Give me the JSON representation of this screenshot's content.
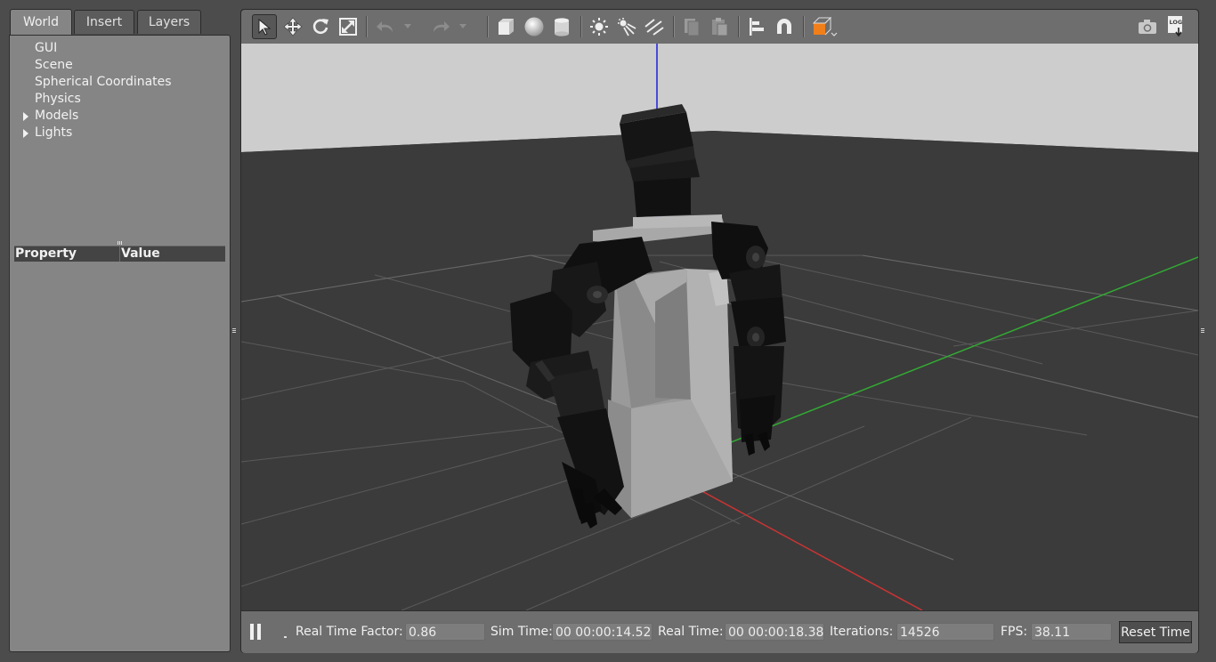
{
  "left_panel": {
    "tabs": [
      {
        "label": "World",
        "active": true
      },
      {
        "label": "Insert",
        "active": false
      },
      {
        "label": "Layers",
        "active": false
      }
    ],
    "tree": [
      {
        "label": "GUI",
        "expandable": false
      },
      {
        "label": "Scene",
        "expandable": false
      },
      {
        "label": "Spherical Coordinates",
        "expandable": false
      },
      {
        "label": "Physics",
        "expandable": false
      },
      {
        "label": "Models",
        "expandable": true
      },
      {
        "label": "Lights",
        "expandable": true
      }
    ],
    "property_header": {
      "property": "Property",
      "value": "Value"
    }
  },
  "toolbar": {
    "tools": [
      {
        "icon": "select-arrow-icon",
        "selected": true
      },
      {
        "icon": "translate-icon"
      },
      {
        "icon": "rotate-icon"
      },
      {
        "icon": "scale-icon"
      },
      {
        "icon": "undo-icon",
        "disabled": true
      },
      {
        "icon": "undo-history-icon",
        "disabled": true
      },
      {
        "icon": "redo-icon",
        "disabled": true
      },
      {
        "icon": "redo-history-icon",
        "disabled": true
      },
      {
        "icon": "box-icon"
      },
      {
        "icon": "sphere-icon"
      },
      {
        "icon": "cylinder-icon"
      },
      {
        "icon": "point-light-icon"
      },
      {
        "icon": "spot-light-icon"
      },
      {
        "icon": "directional-light-icon"
      },
      {
        "icon": "copy-icon"
      },
      {
        "icon": "paste-icon"
      },
      {
        "icon": "align-icon"
      },
      {
        "icon": "snap-icon"
      },
      {
        "icon": "view-angle-icon"
      },
      {
        "icon": "screenshot-icon"
      },
      {
        "icon": "log-icon",
        "label": "LOG"
      }
    ],
    "accent_color": "#f07f1a"
  },
  "status": {
    "real_time_factor_label": "Real Time Factor:",
    "real_time_factor": "0.86",
    "sim_time_label": "Sim Time:",
    "sim_time": "00 00:00:14.526",
    "real_time_label": "Real Time:",
    "real_time": "00 00:00:18.381",
    "iterations_label": "Iterations:",
    "iterations": "14526",
    "fps_label": "FPS:",
    "fps": "38.11",
    "reset_label": "Reset Time"
  },
  "colors": {
    "x_axis": "#cc3333",
    "y_axis": "#33aa33",
    "z_axis": "#2020dd",
    "ground": "#3b3b3b",
    "sky": "#cdcdcd"
  }
}
